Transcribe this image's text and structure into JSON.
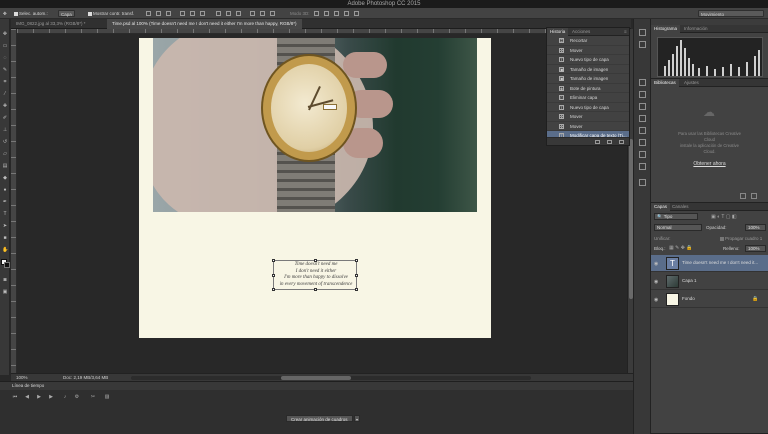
{
  "app": {
    "title": "Adobe Photoshop CC 2015"
  },
  "options_bar": {
    "auto_select_label": "Selec. autom.:",
    "auto_select_value": "Capa",
    "show_transform_label": "Mostrar contr. transf.",
    "mode_3d_label": "Modo 3D:",
    "workspace": "Movimiento"
  },
  "document_tabs": [
    {
      "label": "IMG_0822.jpg al 33,3% (RGB/8*) *"
    },
    {
      "label": "Time.psd al 100% (Time doesn't need me I don't need it either I'm more than happy, RGB/8*)"
    }
  ],
  "canvas": {
    "quote_lines": [
      "Time doesn't need me",
      "I don't need it either",
      "I'm more than happy to dissolve",
      "in every movement of transcendence"
    ]
  },
  "status": {
    "zoom": "100%",
    "doc": "Doc: 2,19 MB/3,64 MB"
  },
  "history": {
    "tabs": [
      "Historia",
      "Acciones"
    ],
    "items": [
      {
        "label": "Recortar",
        "icon": "crop-icon"
      },
      {
        "label": "Mover",
        "icon": "move-icon"
      },
      {
        "label": "Nuevo tipo de capa",
        "icon": "type-icon"
      },
      {
        "label": "Tamaño de imagen",
        "icon": "image-size-icon"
      },
      {
        "label": "Tamaño de imagen",
        "icon": "image-size-icon"
      },
      {
        "label": "Bote de pintura",
        "icon": "paint-bucket-icon"
      },
      {
        "label": "Eliminar capa",
        "icon": "trash-icon"
      },
      {
        "label": "Nuevo tipo de capa",
        "icon": "type-icon"
      },
      {
        "label": "Mover",
        "icon": "move-icon"
      },
      {
        "label": "Mover",
        "icon": "move-icon"
      },
      {
        "label": "Modificar capa de texto (Ti...",
        "icon": "type-icon",
        "selected": true
      }
    ]
  },
  "histogram_panel": {
    "tabs": [
      "Histograma",
      "Información"
    ]
  },
  "libraries_panel": {
    "tabs": [
      "Bibliotecas",
      "Ajustes"
    ],
    "message_line1": "Para usar las Bibliotecas Creative",
    "message_line2": "Cloud",
    "message_line3": "instale la aplicación de Creative",
    "message_line4": "Cloud.",
    "link": "Obtener ahora"
  },
  "layers_panel": {
    "tabs": [
      "Capas",
      "Canales"
    ],
    "filter": "Tipo",
    "blend_mode": "Normal",
    "opacity_label": "Opacidad:",
    "opacity_value": "100%",
    "unify_label": "Unificar:",
    "propagate_label": "Propagar cuadro 1",
    "lock_label": "Bloq.:",
    "fill_label": "Relleno:",
    "fill_value": "100%",
    "layers": [
      {
        "name": "Time doesn't need me I don't need it...",
        "type": "text",
        "selected": true
      },
      {
        "name": "Capa 1",
        "type": "image",
        "selected": false
      },
      {
        "name": "Fondo",
        "type": "fill",
        "selected": false
      }
    ]
  },
  "timeline": {
    "title": "Línea de tiempo",
    "create_button": "Crear animación de cuadros"
  }
}
